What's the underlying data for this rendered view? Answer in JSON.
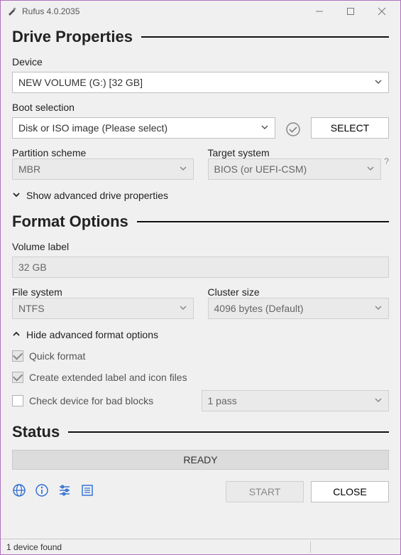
{
  "title": "Rufus 4.0.2035",
  "sections": {
    "drive_props": "Drive Properties",
    "format_opts": "Format Options",
    "status": "Status"
  },
  "labels": {
    "device": "Device",
    "boot_selection": "Boot selection",
    "partition_scheme": "Partition scheme",
    "target_system": "Target system",
    "volume_label": "Volume label",
    "file_system": "File system",
    "cluster_size": "Cluster size"
  },
  "values": {
    "device": "NEW VOLUME (G:) [32 GB]",
    "boot_selection": "Disk or ISO image (Please select)",
    "partition_scheme": "MBR",
    "target_system": "BIOS (or UEFI-CSM)",
    "volume_label": "32 GB",
    "file_system": "NTFS",
    "cluster_size": "4096 bytes (Default)",
    "bad_blocks_passes": "1 pass"
  },
  "buttons": {
    "select": "SELECT",
    "start": "START",
    "close": "CLOSE"
  },
  "expanders": {
    "show_drive": "Show advanced drive properties",
    "hide_format": "Hide advanced format options"
  },
  "checks": {
    "quick_format": "Quick format",
    "extended_label": "Create extended label and icon files",
    "bad_blocks": "Check device for bad blocks"
  },
  "status_text": "READY",
  "footer": {
    "device_count": "1 device found"
  },
  "help_mark": "?"
}
